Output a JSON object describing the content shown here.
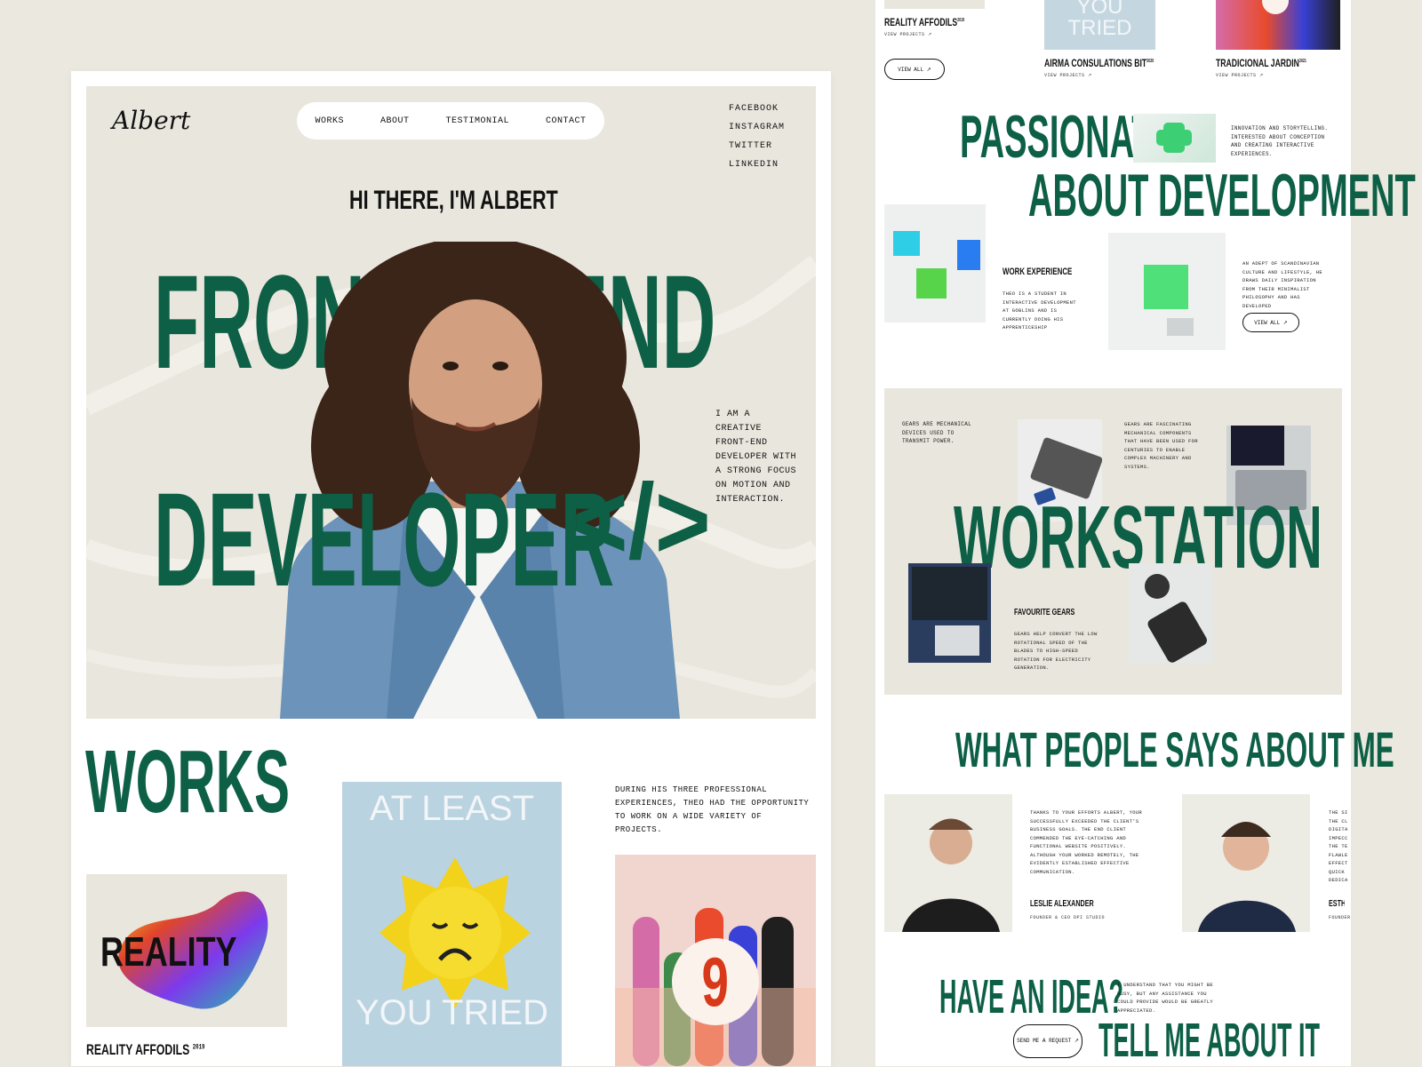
{
  "brand": {
    "logo": "Albert",
    "accent": "#0d5f45",
    "background": "#eae8df"
  },
  "nav": {
    "items": [
      "WORKS",
      "ABOUT",
      "TESTIMONIAL",
      "CONTACT"
    ]
  },
  "socials": [
    "FACEBOOK",
    "INSTAGRAM",
    "TWITTER",
    "LINKEDIN"
  ],
  "hero": {
    "greeting": "HI THERE, I'M ALBERT",
    "word1": "FRONT",
    "word2": "END",
    "word3": "DEVELOPER",
    "code_symbol": "</>",
    "intro": "I AM A CREATIVE FRONT-END DEVELOPER WITH A STRONG FOCUS ON MOTION AND INTERACTION."
  },
  "works": {
    "title": "WORKS",
    "description": "DURING HIS THREE PROFESSIONAL EXPERIENCES, THEO HAD THE OPPORTUNITY TO WORK ON A WIDE VARIETY OF PROJECTS.",
    "project1": {
      "name": "REALITY AFFODILS",
      "year": "2019",
      "art_text": "REALITY"
    },
    "project2": {
      "art_text_top": "AT LEAST",
      "art_text_bottom": "YOU TRIED"
    },
    "project3": {
      "art_number": "9"
    }
  },
  "right": {
    "top": {
      "p1_name": "REALITY AFFODILS",
      "p1_year": "2019",
      "p1_link": "VIEW PROJECTS ↗",
      "p2_name": "AIRMA CONSULATIONS BIT",
      "p2_year": "2020",
      "p2_link": "VIEW PROJECTS ↗",
      "p3_name": "TRADICIONAL JARDIN",
      "p3_year": "2021",
      "p3_link": "VIEW PROJECTS ↗",
      "view_all": "VIEW ALL ↗",
      "art_text": "YOU TRIED"
    },
    "passion": {
      "line1": "PASSIONATE",
      "line2": "ABOUT DEVELOPMENT",
      "blurb": "INNOVATION AND STORYTELLING. INTERESTED ABOUT CONCEPTION AND CREATING INTERACTIVE EXPERIENCES.",
      "exp_title": "WORK EXPERIENCE",
      "exp_text": "THEO IS A STUDENT IN INTERACTIVE DEVELOPMENT AT GOBLINS AND IS CURRENTLY DOING HIS APPRENTICESHIP",
      "side_text": "AN ADEPT OF SCANDINAVIAN CULTURE AND LIFESTYLE, HE DRAWS DAILY INSPIRATION FROM THEIR MINIMALIST PHILOSOPHY AND HAS DEVELOPED",
      "view_all": "VIEW ALL ↗"
    },
    "workstation": {
      "title": "WORKSTATION",
      "text1": "GEARS ARE MECHANICAL DEVICES USED TO TRANSMIT POWER.",
      "text2": "GEARS ARE FASCINATING MECHANICAL COMPONENTS THAT HAVE BEEN USED FOR CENTURIES TO ENABLE COMPLEX MACHINERY AND SYSTEMS.",
      "fav_title": "FAVOURITE GEARS",
      "fav_text": "GEARS HELP CONVERT THE LOW ROTATIONAL SPEED OF THE BLADES TO HIGH-SPEED ROTATION FOR ELECTRICITY GENERATION."
    },
    "testimonials": {
      "title": "WHAT PEOPLE SAYS ABOUT ME",
      "quote1": "THANKS TO YOUR EFFORTS ALBERT, YOUR SUCCESSFULLY EXCEEDED THE CLIENT'S BUSINESS GOALS. THE END CLIENT COMMENDED THE EYE-CATCHING AND FUNCTIONAL WEBSITE POSITIVELY. ALTHOUGH YOUR WORKED REMOTELY, THE EVIDENTLY ESTABLISHED EFFECTIVE COMMUNICATION.",
      "name1": "LESLIE ALEXANDER",
      "role1": "FOUNDER & CEO DPI STUDIO",
      "quote2_partial": "THE SI\nTHE CL\nDIGITA\nIMPECC\nTHE TE\nFLAWLE\nEFFECT\nQUICK\nDEDICA",
      "name2_partial": "ESTHER",
      "role2_partial": "FOUNDER"
    },
    "cta": {
      "line1": "HAVE AN IDEA?",
      "line2": "TELL ME ABOUT IT",
      "text": "I UNDERSTAND THAT YOU MIGHT BE BUSY, BUT ANY ASSISTANCE YOU COULD PROVIDE WOULD BE GREATLY APPRECIATED.",
      "button": "SEND ME A REQUEST ↗"
    }
  }
}
